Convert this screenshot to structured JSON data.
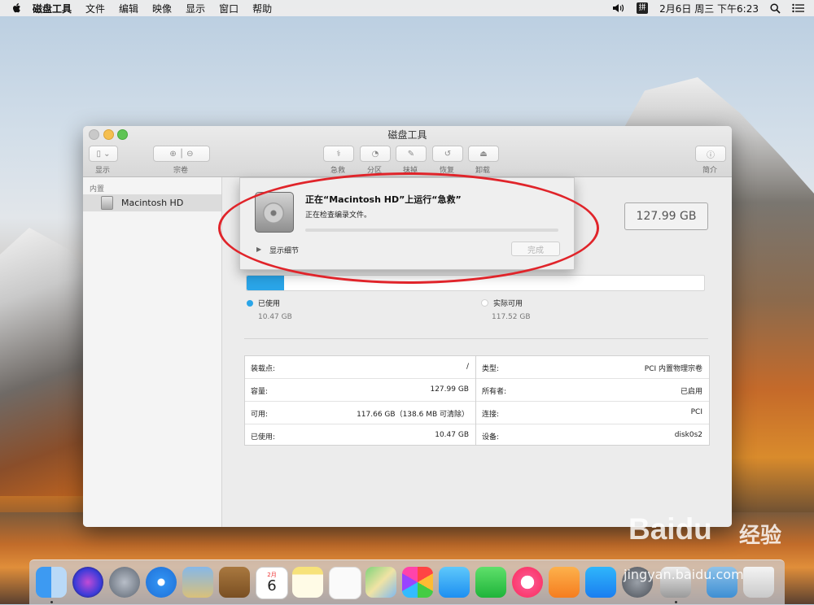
{
  "menubar": {
    "app_name": "磁盘工具",
    "items": [
      "文件",
      "编辑",
      "映像",
      "显示",
      "窗口",
      "帮助"
    ],
    "ime": "拼",
    "clock": "2月6日 周三 下午6:23"
  },
  "window": {
    "title": "磁盘工具",
    "toolbar": {
      "view_label": "显示",
      "volume_label": "宗卷",
      "first_aid_label": "急救",
      "partition_label": "分区",
      "erase_label": "抹掉",
      "restore_label": "恢复",
      "unmount_label": "卸载",
      "info_label": "简介"
    },
    "sidebar": {
      "section": "内置",
      "items": [
        {
          "label": "Macintosh HD"
        }
      ]
    },
    "main": {
      "capacity": "127.99 GB",
      "usage_fraction": 0.082,
      "legend": {
        "used_label": "已使用",
        "used_value": "10.47 GB",
        "available_label": "实际可用",
        "available_value": "117.52 GB"
      },
      "info_left": [
        {
          "key": "装载点:",
          "value": "/"
        },
        {
          "key": "容量:",
          "value": "127.99 GB"
        },
        {
          "key": "可用:",
          "value": "117.66 GB（138.6 MB 可清除）"
        },
        {
          "key": "已使用:",
          "value": "10.47 GB"
        }
      ],
      "info_right": [
        {
          "key": "类型:",
          "value": "PCI 内置物理宗卷"
        },
        {
          "key": "所有者:",
          "value": "已启用"
        },
        {
          "key": "连接:",
          "value": "PCI"
        },
        {
          "key": "设备:",
          "value": "disk0s2"
        }
      ]
    },
    "sheet": {
      "title": "正在“Macintosh HD”上运行“急救”",
      "status": "正在检查编录文件。",
      "progress": 0.0,
      "details_label": "显示细节",
      "done_label": "完成"
    }
  },
  "dock": {
    "calendar_month": "2月",
    "calendar_day": "6"
  },
  "watermark": {
    "brand": "Baidu",
    "cn": "经验",
    "url": "jingyan.baidu.com"
  },
  "colors": {
    "used_blue": "#2aa5e8",
    "annotation_red": "#e0242a"
  }
}
